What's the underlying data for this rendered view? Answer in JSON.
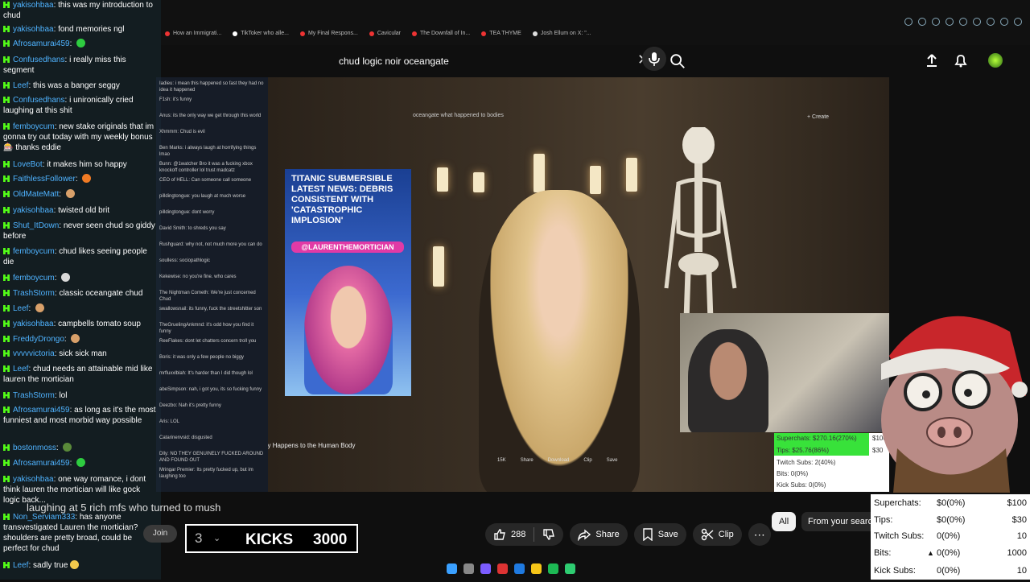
{
  "browser": {
    "tabs": [
      "How an Immigrati...",
      "TikToker who alle...",
      "My Final Respons...",
      "Cavicular",
      "The Downfall of In...",
      "TEA THYME",
      "Josh Ellum on X: \"..."
    ]
  },
  "search": {
    "query": "chud logic noir oceangate"
  },
  "video": {
    "thumbnail_title": "TITANIC SUBMERSIBLE LATEST NEWS: DEBRIS CONSISTENT WITH 'CATASTROPHIC IMPLOSION'",
    "thumbnail_handle": "@LAURENTHEMORTICIAN",
    "inner_search": "oceangate what happened to bodies",
    "inner_create": "+ Create",
    "inner_caption": "Titan Implosion: What Really Happens to the Human Body",
    "inner_actions": [
      "15K",
      "Share",
      "Download",
      "Clip",
      "Save"
    ]
  },
  "chat": [
    {
      "user": "yakisohbaa",
      "text": "this was my introduction to chud",
      "emote": ""
    },
    {
      "user": "yakisohbaa",
      "text": "fond memories ngl",
      "emote": ""
    },
    {
      "user": "Afrosamurai459",
      "text": "",
      "emote": "green-emote"
    },
    {
      "user": "Confusedhans",
      "text": "i really miss this segment",
      "emote": ""
    },
    {
      "user": "Leef",
      "text": "this was a banger seggy",
      "emote": ""
    },
    {
      "user": "Confusedhans",
      "text": "i unironically cried laughing at this shit",
      "emote": ""
    },
    {
      "user": "femboycum",
      "text": "new stake originals that im gonna try out today with my weekly bonus 🎰 thanks eddie",
      "emote": ""
    },
    {
      "user": "LoveBot",
      "text": "it makes him so happy",
      "emote": ""
    },
    {
      "user": "FaithlessFollower",
      "text": "",
      "emote": "orange-emote"
    },
    {
      "user": "OldMateMatt",
      "text": "",
      "emote": "face-emote"
    },
    {
      "user": "yakisohbaa",
      "text": "twisted old brit",
      "emote": ""
    },
    {
      "user": "Shut_ItDown",
      "text": "never seen chud so giddy before",
      "emote": ""
    },
    {
      "user": "femboycum",
      "text": "chud likes seeing people die",
      "emote": ""
    },
    {
      "user": "femboycum",
      "text": "",
      "emote": "cup-emote"
    },
    {
      "user": "TrashStorm",
      "text": "classic oceangate chud",
      "emote": ""
    },
    {
      "user": "Leef",
      "text": "",
      "emote": "picture-emote"
    },
    {
      "user": "yakisohbaa",
      "text": "campbells tomato soup",
      "emote": ""
    },
    {
      "user": "FreddyDrongo",
      "text": "",
      "emote": "face-emote"
    },
    {
      "user": "vvvvvictoria",
      "text": "sick sick man",
      "emote": ""
    },
    {
      "user": "Leef",
      "text": "chud needs an attainable mid like lauren the mortician",
      "emote": ""
    },
    {
      "user": "TrashStorm",
      "text": "lol",
      "emote": ""
    },
    {
      "user": "Afrosamurai459",
      "text": "as long as it's the most funniest and most morbid way possible",
      "emote": ""
    },
    {
      "user": "bostonmoss",
      "text": "",
      "emote": "tree-emote"
    },
    {
      "user": "Afrosamurai459",
      "text": "",
      "emote": "green-emote"
    },
    {
      "user": "yakisohbaa",
      "text": "one way romance, i dont think lauren the mortician will like gock logic back...",
      "emote": ""
    },
    {
      "user": "Non_Serviam333",
      "text": "has anyone transvestigated Lauren the mortician? shoulders are pretty broad, could be perfect for chud",
      "emote": ""
    },
    {
      "user": "Leef",
      "text": "sadly true",
      "emote": "sad-emote"
    }
  ],
  "chat2": [
    "Iadieu: i mean this happened so fast they had no idea it happened",
    "F1sh: it's funny",
    "Anus: its the only way we get through this world",
    "Xhmmm: Chud is evil",
    "Ben Marks: i always laugh at horrifying things lmao",
    "Bunn: @1watcher Bro it was a fucking xbox knockoff controller lol trust madcatz",
    "CEO of HELL: Can someone call someone",
    "pilldingtongue: you laugh at much worse",
    "pilldingtongue: dont worry",
    "David Smith: to shreds you say",
    "Rushguard: why not, not much more you can do",
    "soulless: sociopathlogic",
    "Kekewise: no you're fine. who cares",
    "The Nightman Cometh: We're just concerned Chud",
    "swallowsnail: its funny, fuck the streetshitter son",
    "TheGruelingAnkmnd: it's odd how you find it funny",
    "ReeFlakes: dont let chatters concern troll you",
    "Boris: it was only a few people no biggy",
    "mrfluxxlblah: It's harder than I did though lol",
    "abeSimpson: nah, i got you, its so fucking funny",
    "Deezbo: Nah it's pretty funny",
    "Aris: LOL",
    "Catarinenvsid: disgusted",
    "Dlly: NO THEY GENUINELY FUCKED AROUND AND FOUND OUT",
    "Mringar Premier: Its pretty fucked up, but im laughing too"
  ],
  "stream": {
    "title": "laughing at 5 rich mfs who turned to mush",
    "join_label": "Join",
    "kicks_count": "3",
    "kicks_label": "KICKS",
    "kicks_goal": "3000"
  },
  "actions": {
    "likes": "288",
    "share_label": "Share",
    "save_label": "Save",
    "clip_label": "Clip"
  },
  "chips": {
    "all": "All",
    "from": "From your search"
  },
  "donation_mini": [
    {
      "label": "Superchats: $270.16(270%)",
      "goal": "$100"
    },
    {
      "label": "Tips: $25.76(86%)",
      "goal": "$30"
    },
    {
      "label": "Twitch Subs: 2(40%)",
      "goal": ""
    },
    {
      "label": "Bits: 0(0%)",
      "goal": ""
    },
    {
      "label": "Kick Subs: 0(0%)",
      "goal": ""
    }
  ],
  "donations": [
    {
      "label": "Superchats:",
      "value": "$0(0%)",
      "goal": "$100"
    },
    {
      "label": "Tips:",
      "value": "$0(0%)",
      "goal": "$30"
    },
    {
      "label": "Twitch Subs:",
      "value": "0(0%)",
      "goal": "10"
    },
    {
      "label": "Bits:",
      "value": "0(0%)",
      "goal": "1000"
    },
    {
      "label": "Kick Subs:",
      "value": "0(0%)",
      "goal": "10"
    }
  ],
  "colors": {
    "kick_green": "#53fc18",
    "chat_user": "#4fb3ff",
    "yt_dark": "#0f0f0f",
    "pill": "#272727"
  }
}
